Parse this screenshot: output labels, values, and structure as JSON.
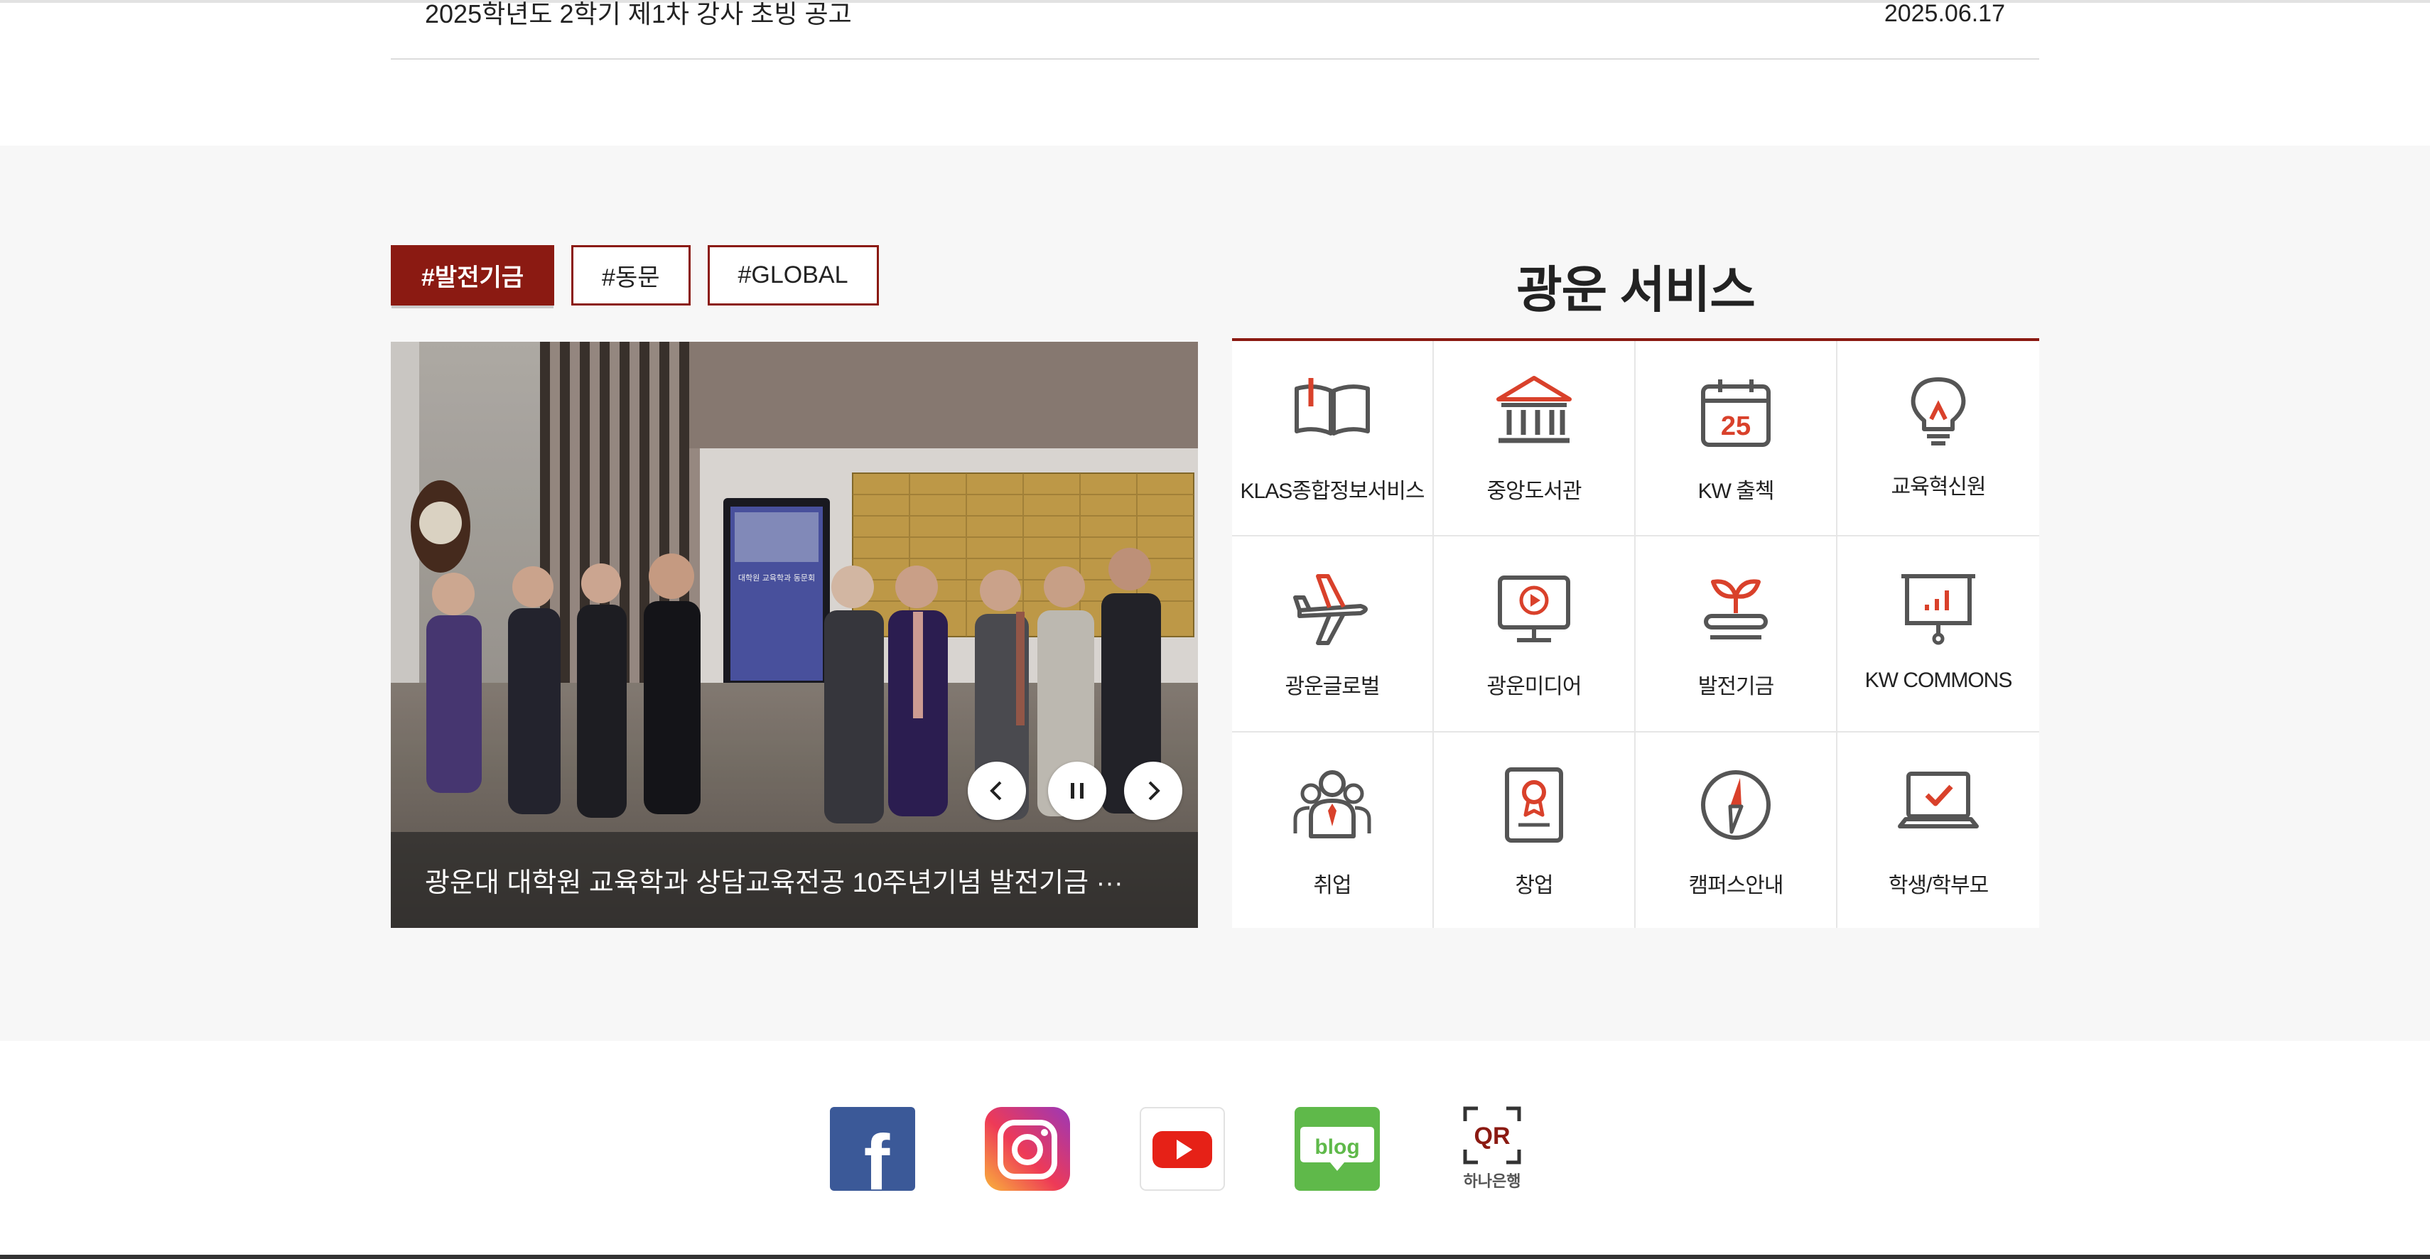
{
  "notice": {
    "title": "2025학년도 2학기 제1차 강사 초빙 공고",
    "date": "2025.06.17"
  },
  "tags": [
    {
      "label": "#발전기금",
      "active": true
    },
    {
      "label": "#동문",
      "active": false
    },
    {
      "label": "#GLOBAL",
      "active": false
    }
  ],
  "slider": {
    "caption": "광운대 대학원 교육학과 상담교육전공 10주년기념 발전기금 ···",
    "photo_sign_text": "대학원 교육학과 동문회",
    "controls": {
      "prev": "previous",
      "pause": "pause",
      "next": "next"
    }
  },
  "services": {
    "title": "광운 서비스",
    "items": [
      {
        "label": "KLAS종합정보서비스",
        "icon": "book-icon"
      },
      {
        "label": "중앙도서관",
        "icon": "library-icon"
      },
      {
        "label": "KW 출첵",
        "icon": "calendar-icon",
        "icon_text": "25"
      },
      {
        "label": "교육혁신원",
        "icon": "lightbulb-icon"
      },
      {
        "label": "광운글로벌",
        "icon": "airplane-icon"
      },
      {
        "label": "광운미디어",
        "icon": "monitor-play-icon"
      },
      {
        "label": "발전기금",
        "icon": "sprout-icon"
      },
      {
        "label": "KW COMMONS",
        "icon": "presentation-icon"
      },
      {
        "label": "취업",
        "icon": "people-icon"
      },
      {
        "label": "창업",
        "icon": "certificate-icon"
      },
      {
        "label": "캠퍼스안내",
        "icon": "compass-icon"
      },
      {
        "label": "학생/학부모",
        "icon": "laptop-check-icon"
      }
    ]
  },
  "social": {
    "facebook_glyph": "f",
    "blog_text": "blog",
    "qr_text": "QR",
    "qr_caption": "하나은행"
  },
  "colors": {
    "accent": "#8b1a12",
    "icon_gray": "#555555",
    "icon_red": "#d9412b",
    "facebook": "#3b5998",
    "youtube": "#e62117",
    "blog": "#5fb94a"
  }
}
